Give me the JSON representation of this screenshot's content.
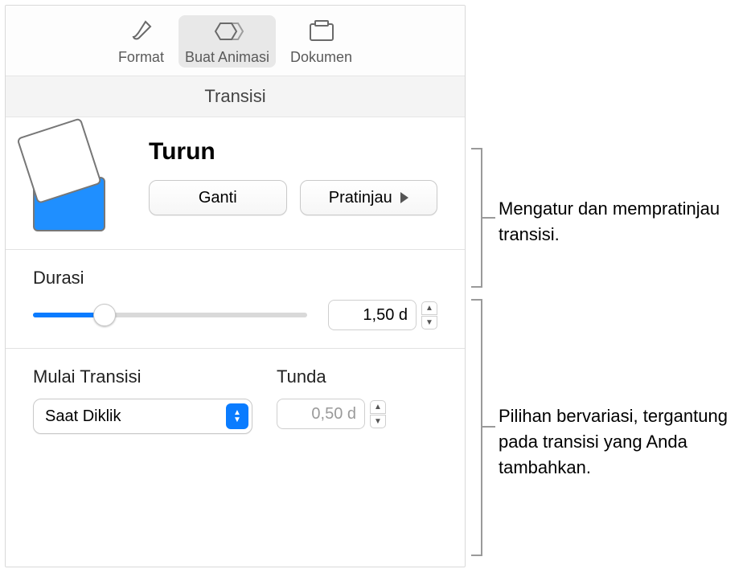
{
  "toolbar": {
    "format_label": "Format",
    "animate_label": "Buat Animasi",
    "document_label": "Dokumen"
  },
  "subheader": {
    "tab_label": "Transisi"
  },
  "transition": {
    "name": "Turun",
    "change_label": "Ganti",
    "preview_label": "Pratinjau"
  },
  "duration": {
    "label": "Durasi",
    "value": "1,50 d",
    "slider_percent": 26
  },
  "start": {
    "label": "Mulai Transisi",
    "selected": "Saat Diklik"
  },
  "delay": {
    "label": "Tunda",
    "value": "0,50 d"
  },
  "callouts": {
    "top": "Mengatur dan mempratinjau transisi.",
    "bottom": "Pilihan bervariasi, tergantung pada transisi yang Anda tambahkan."
  }
}
